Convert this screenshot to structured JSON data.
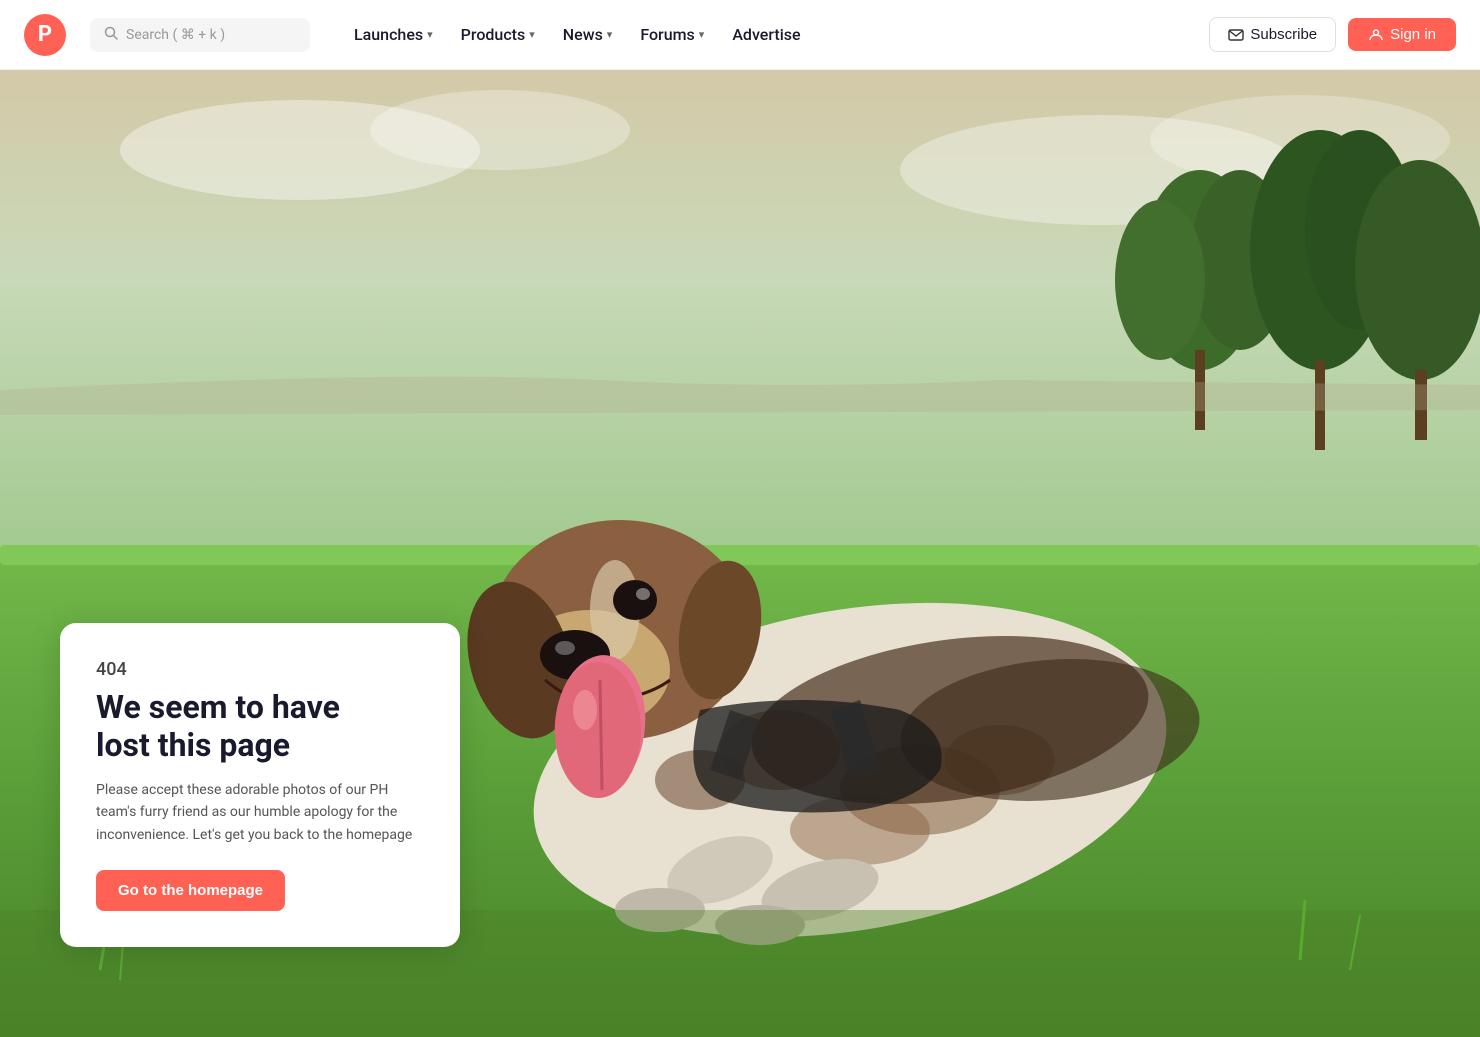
{
  "header": {
    "logo_letter": "P",
    "search_placeholder": "Search ( ⌘ + k )",
    "nav_items": [
      {
        "label": "Launches",
        "has_dropdown": true
      },
      {
        "label": "Products",
        "has_dropdown": true
      },
      {
        "label": "News",
        "has_dropdown": true
      },
      {
        "label": "Forums",
        "has_dropdown": true
      },
      {
        "label": "Advertise",
        "has_dropdown": false
      }
    ],
    "subscribe_label": "Subscribe",
    "signin_label": "Sign in"
  },
  "error_page": {
    "code": "404",
    "title_line1": "We seem to have",
    "title_line2": "lost this page",
    "description": "Please accept these adorable photos of our PH team's furry friend as our humble apology for the inconvenience. Let's get you back to the homepage",
    "cta_label": "Go to the homepage"
  },
  "colors": {
    "brand": "#ff6154",
    "text_dark": "#1a1a2e",
    "text_muted": "#555555"
  }
}
